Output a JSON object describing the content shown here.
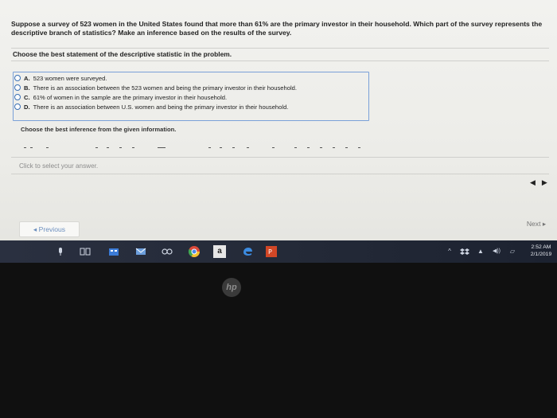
{
  "question": {
    "text": "Suppose a survey of 523 women in the United States found that more than 61% are the primary investor in their household. Which part of the survey represents the descriptive branch of statistics? Make an inference based on the results of the survey."
  },
  "part1": {
    "instruction": "Choose the best statement of the descriptive statistic in the problem.",
    "options": [
      {
        "letter": "A.",
        "text": "523 women were surveyed."
      },
      {
        "letter": "B.",
        "text": "There is an association between the 523 women and being the primary investor in their household."
      },
      {
        "letter": "C.",
        "text": "61% of women in the sample are the primary investor in their household."
      },
      {
        "letter": "D.",
        "text": "There is an association between U.S. women and being the primary investor in their household."
      }
    ]
  },
  "part2": {
    "instruction": "Choose the best inference from the given information."
  },
  "answer_hint": "Click to select your answer.",
  "nav": {
    "previous_label": "◂ Previous",
    "next_label": "Next ▸"
  },
  "taskbar": {
    "time": "2:52 AM",
    "date": "2/1/2019",
    "amazon_label": "a",
    "tray_up": "^",
    "tray_network": "▲",
    "tray_volume": "◀))",
    "tray_notify": "▱"
  },
  "bezel": {
    "logo_text": "hp"
  },
  "colors": {
    "radio_border": "#3a6fb4",
    "link_blue": "#6c8fbf",
    "taskbar_bg": "#242a38"
  }
}
